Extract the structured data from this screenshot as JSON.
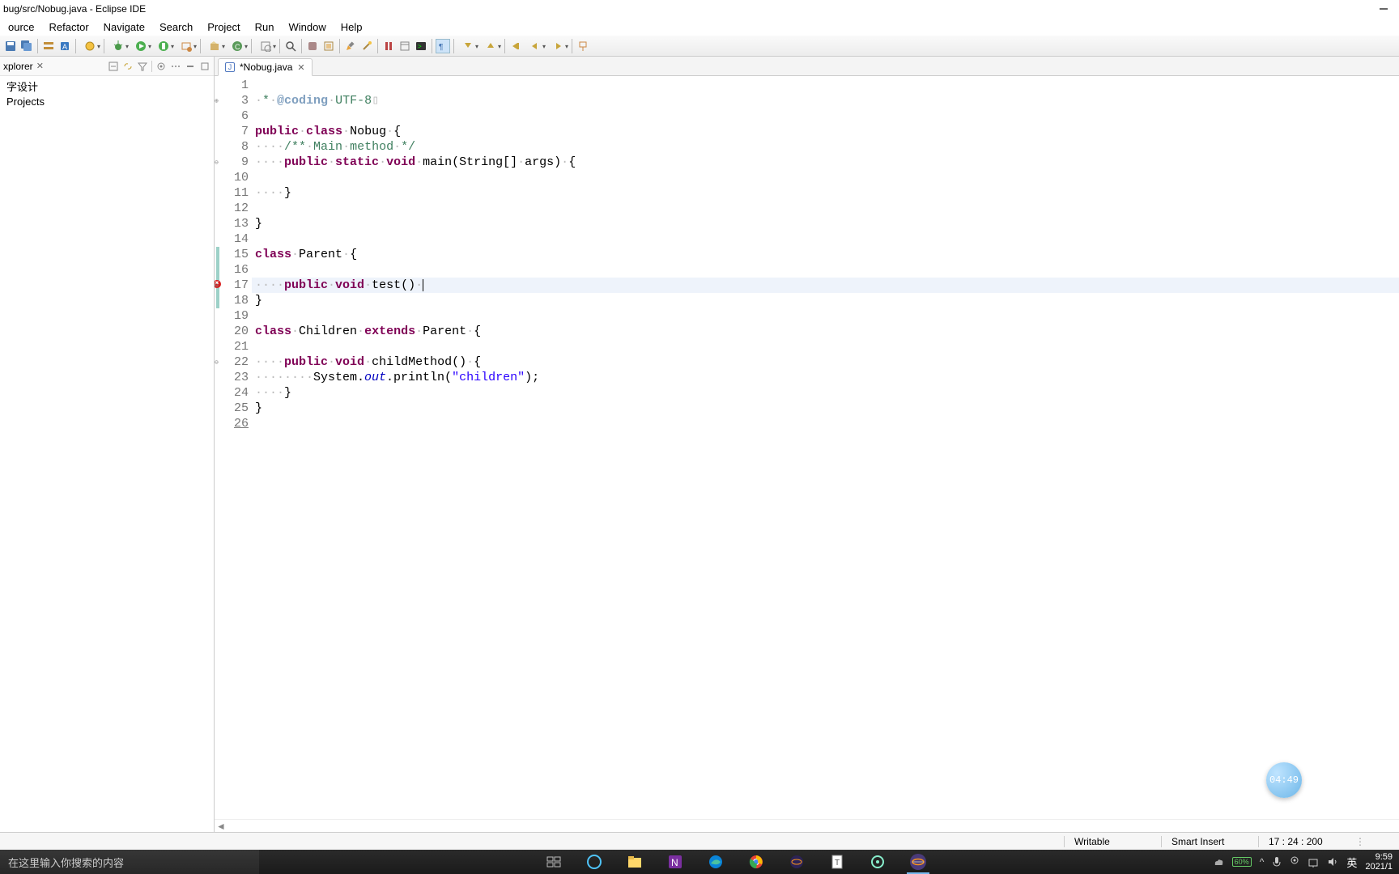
{
  "window": {
    "title": "bug/src/Nobug.java - Eclipse IDE"
  },
  "menu": [
    "ource",
    "Refactor",
    "Navigate",
    "Search",
    "Project",
    "Run",
    "Window",
    "Help"
  ],
  "explorer": {
    "title": "xplorer",
    "items": [
      "字设计",
      "Projects"
    ]
  },
  "editor": {
    "tab_icon_letter": "J",
    "tab_label": "*Nobug.java",
    "lines": [
      {
        "n": "1",
        "fold": "",
        "change": false,
        "error": false,
        "hl": false,
        "html": ""
      },
      {
        "n": "3",
        "fold": "⊕",
        "change": false,
        "error": false,
        "hl": false,
        "html": "<span class='ws'>·</span><span class='cm'>*</span><span class='ws'>·</span><span class='tag'>@coding</span><span class='ws'>·</span><span class='cm'>UTF-8</span><span class='ws'>▯</span>"
      },
      {
        "n": "6",
        "fold": "",
        "change": false,
        "error": false,
        "hl": false,
        "html": ""
      },
      {
        "n": "7",
        "fold": "",
        "change": false,
        "error": false,
        "hl": false,
        "html": "<span class='kw'>public</span><span class='ws'>·</span><span class='kw'>class</span><span class='ws'>·</span>Nobug<span class='ws'>·</span>{"
      },
      {
        "n": "8",
        "fold": "",
        "change": false,
        "error": false,
        "hl": false,
        "html": "<span class='ws'>····</span><span class='cm'>/**</span><span class='ws'>·</span><span class='cm'>Main</span><span class='ws'>·</span><span class='cm'>method</span><span class='ws'>·</span><span class='cm'>*/</span>"
      },
      {
        "n": "9",
        "fold": "⊖",
        "change": false,
        "error": false,
        "hl": false,
        "html": "<span class='ws'>····</span><span class='kw'>public</span><span class='ws'>·</span><span class='kw'>static</span><span class='ws'>·</span><span class='kw'>void</span><span class='ws'>·</span>main(String[]<span class='ws'>·</span>args)<span class='ws'>·</span>{"
      },
      {
        "n": "10",
        "fold": "",
        "change": false,
        "error": false,
        "hl": false,
        "html": ""
      },
      {
        "n": "11",
        "fold": "",
        "change": false,
        "error": false,
        "hl": false,
        "html": "<span class='ws'>····</span>}"
      },
      {
        "n": "12",
        "fold": "",
        "change": false,
        "error": false,
        "hl": false,
        "html": ""
      },
      {
        "n": "13",
        "fold": "",
        "change": false,
        "error": false,
        "hl": false,
        "html": "}"
      },
      {
        "n": "14",
        "fold": "",
        "change": false,
        "error": false,
        "hl": false,
        "html": ""
      },
      {
        "n": "15",
        "fold": "",
        "change": true,
        "error": false,
        "hl": false,
        "html": "<span class='kw'>class</span><span class='ws'>·</span>Parent<span class='ws'>·</span>{"
      },
      {
        "n": "16",
        "fold": "",
        "change": true,
        "error": false,
        "hl": false,
        "html": ""
      },
      {
        "n": "17",
        "fold": "⊖",
        "change": true,
        "error": true,
        "hl": true,
        "html": "<span class='ws'>····</span><span class='kw err-underline'>public</span><span class='ws'>·</span><span class='kw'>void</span><span class='ws'>·</span>test()<span class='ws'>·</span><span class='cursor'></span>"
      },
      {
        "n": "18",
        "fold": "",
        "change": true,
        "error": false,
        "hl": false,
        "html": "}"
      },
      {
        "n": "19",
        "fold": "",
        "change": false,
        "error": false,
        "hl": false,
        "html": ""
      },
      {
        "n": "20",
        "fold": "",
        "change": false,
        "error": false,
        "hl": false,
        "html": "<span class='kw'>class</span><span class='ws'>·</span>Children<span class='ws'>·</span><span class='kw'>extends</span><span class='ws'>·</span>Parent<span class='ws'>·</span>{"
      },
      {
        "n": "21",
        "fold": "",
        "change": false,
        "error": false,
        "hl": false,
        "html": ""
      },
      {
        "n": "22",
        "fold": "⊖",
        "change": false,
        "error": false,
        "hl": false,
        "html": "<span class='ws'>····</span><span class='kw'>public</span><span class='ws'>·</span><span class='kw'>void</span><span class='ws'>·</span>childMethod()<span class='ws'>·</span>{"
      },
      {
        "n": "23",
        "fold": "",
        "change": false,
        "error": false,
        "hl": false,
        "html": "<span class='ws'>········</span>System.<span class='it'>out</span>.println(<span class='str'>\"children\"</span>);"
      },
      {
        "n": "24",
        "fold": "",
        "change": false,
        "error": false,
        "hl": false,
        "html": "<span class='ws'>····</span>}"
      },
      {
        "n": "25",
        "fold": "",
        "change": false,
        "error": false,
        "hl": false,
        "html": "}"
      },
      {
        "n": "26",
        "fold": "",
        "change": false,
        "error": false,
        "hl": false,
        "html": "",
        "underline": true
      }
    ]
  },
  "bubble": "04:49",
  "status": {
    "writable": "Writable",
    "insert": "Smart Insert",
    "cursor": "17 : 24 : 200"
  },
  "taskbar": {
    "search_placeholder": "在这里输入你搜索的内容",
    "battery": "60%",
    "ime": "英",
    "clock_time": "9:59",
    "clock_date": "2021/1"
  }
}
